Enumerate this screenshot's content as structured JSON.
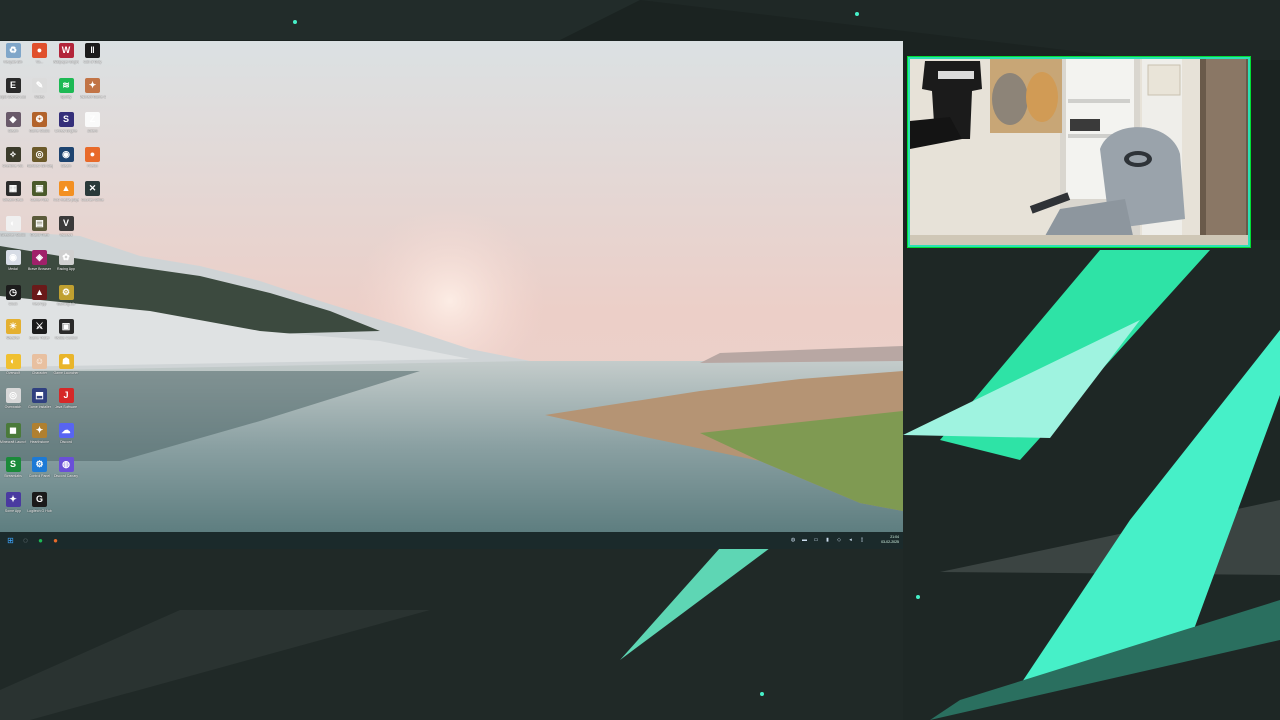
{
  "stream": {
    "accent_color": "#3ee8c0",
    "background_color": "#1a2220"
  },
  "desktop": {
    "icons": [
      {
        "name": "recycle-bin-icon",
        "label": "Recycle Bin",
        "color": "#7fa6c9",
        "glyph": "♻"
      },
      {
        "name": "app-icon",
        "label": "Vo...",
        "color": "#e0502c",
        "glyph": "●"
      },
      {
        "name": "app-icon",
        "label": "Wallpaper Engine",
        "color": "#b3253a",
        "glyph": "W"
      },
      {
        "name": "app-icon",
        "label": "Call of Duty",
        "color": "#1b1b1b",
        "glyph": "‖"
      },
      {
        "name": "app-icon",
        "label": "Epic Games Launcher",
        "color": "#2a2a2a",
        "glyph": "E"
      },
      {
        "name": "app-icon",
        "label": "Notes",
        "color": "#dcdcdc",
        "glyph": "✎"
      },
      {
        "name": "spotify-icon",
        "label": "Spotify",
        "color": "#1db954",
        "glyph": "≋"
      },
      {
        "name": "app-icon",
        "label": "Valorant Game Client",
        "color": "#c27446",
        "glyph": "✦"
      },
      {
        "name": "app-icon",
        "label": "Steam",
        "color": "#6a5a6a",
        "glyph": "◆"
      },
      {
        "name": "app-icon",
        "label": "Game Studio",
        "color": "#b3632b",
        "glyph": "❂"
      },
      {
        "name": "app-icon",
        "label": "Unreal Engine",
        "color": "#352f7a",
        "glyph": "S"
      },
      {
        "name": "app-icon",
        "label": "Zotero",
        "color": "#fafafa",
        "glyph": "Z"
      },
      {
        "name": "app-icon",
        "label": "Overtime Vol.",
        "color": "#3b3b2b",
        "glyph": "⟡"
      },
      {
        "name": "app-icon",
        "label": "Rainbow Six Siege",
        "color": "#6b5a2a",
        "glyph": "◎"
      },
      {
        "name": "steam-icon",
        "label": "Steam",
        "color": "#1e4470",
        "glyph": "◉"
      },
      {
        "name": "firefox-icon",
        "label": "Firefox",
        "color": "#e86a2a",
        "glyph": "●"
      },
      {
        "name": "app-icon",
        "label": "Stream Deck",
        "color": "#2b2b2b",
        "glyph": "▦"
      },
      {
        "name": "app-icon",
        "label": "Game Files",
        "color": "#4a5a2a",
        "glyph": "▣"
      },
      {
        "name": "vlc-icon",
        "label": "VLC media player",
        "color": "#f39021",
        "glyph": "▲"
      },
      {
        "name": "app-icon",
        "label": "Counter-Strike",
        "color": "#2a3a3a",
        "glyph": "✕"
      },
      {
        "name": "app-icon",
        "label": "Streamer Studio",
        "color": "#f0f0f0",
        "glyph": "◐"
      },
      {
        "name": "app-icon",
        "label": "Grand Theft",
        "color": "#5a5a3a",
        "glyph": "▤"
      },
      {
        "name": "app-icon",
        "label": "Valorant",
        "color": "#3a3a3a",
        "glyph": "V"
      },
      {
        "name": "app-icon",
        "label": "Medal",
        "color": "#d8dde6",
        "glyph": "◉"
      },
      {
        "name": "app-icon",
        "label": "Brave Browser",
        "color": "#a0206a",
        "glyph": "◈"
      },
      {
        "name": "app-icon",
        "label": "Racing App",
        "color": "#d0d0d0",
        "glyph": "✿"
      },
      {
        "name": "app-icon",
        "label": "Clock",
        "color": "#1c1c1c",
        "glyph": "◷"
      },
      {
        "name": "app-icon",
        "label": "Red App",
        "color": "#6a1a1a",
        "glyph": "▲"
      },
      {
        "name": "app-icon",
        "label": "Gaming Lib",
        "color": "#c0a030",
        "glyph": "⚙"
      },
      {
        "name": "app-icon",
        "label": "Weather",
        "color": "#e4b030",
        "glyph": "☀"
      },
      {
        "name": "app-icon",
        "label": "Game Trailer",
        "color": "#1b1b1b",
        "glyph": "⚔"
      },
      {
        "name": "app-icon",
        "label": "Nvidia Control",
        "color": "#2a2a2a",
        "glyph": "▣"
      },
      {
        "name": "app-icon",
        "label": "Overwolf",
        "color": "#f0c030",
        "glyph": "◐"
      },
      {
        "name": "app-icon",
        "label": "Character",
        "color": "#e8c0a0",
        "glyph": "☺"
      },
      {
        "name": "app-icon",
        "label": "Game Launcher",
        "color": "#e9b52a",
        "glyph": "☗"
      },
      {
        "name": "app-icon",
        "label": "Overwatch",
        "color": "#d8d8d8",
        "glyph": "◎"
      },
      {
        "name": "app-icon",
        "label": "Game Installer",
        "color": "#304080",
        "glyph": "⬒"
      },
      {
        "name": "app-icon",
        "label": "Java Software",
        "color": "#d62828",
        "glyph": "J"
      },
      {
        "name": "app-icon",
        "label": "Minecraft Launcher",
        "color": "#4a7a3a",
        "glyph": "◼"
      },
      {
        "name": "app-icon",
        "label": "Hearthstone",
        "color": "#b08030",
        "glyph": "✦"
      },
      {
        "name": "discord-icon",
        "label": "Discord",
        "color": "#5865f2",
        "glyph": "☁"
      },
      {
        "name": "app-icon",
        "label": "Streamlabs",
        "color": "#1b8a3a",
        "glyph": "S"
      },
      {
        "name": "app-icon",
        "label": "Control Panel",
        "color": "#1d7ad6",
        "glyph": "⚙"
      },
      {
        "name": "app-icon",
        "label": "Discord Canary",
        "color": "#6a50d8",
        "glyph": "◍"
      },
      {
        "name": "app-icon",
        "label": "Some App",
        "color": "#4a3aa0",
        "glyph": "✦"
      },
      {
        "name": "app-icon",
        "label": "Logitech G Hub",
        "color": "#1a1a1a",
        "glyph": "G"
      }
    ]
  },
  "taskbar": {
    "buttons": [
      {
        "name": "start-icon",
        "glyph": "⊞",
        "color": "#3ca6ff"
      },
      {
        "name": "search-icon",
        "glyph": "◌",
        "color": "#bfc8d0"
      },
      {
        "name": "spotify-icon",
        "glyph": "●",
        "color": "#1db954"
      },
      {
        "name": "firefox-icon",
        "glyph": "●",
        "color": "#e86a2a"
      }
    ],
    "tray": [
      {
        "name": "tray-app-icon",
        "glyph": "◍"
      },
      {
        "name": "tray-monitor-icon",
        "glyph": "▬"
      },
      {
        "name": "tray-app-icon",
        "glyph": "▭"
      },
      {
        "name": "tray-app-icon",
        "glyph": "▮"
      },
      {
        "name": "network-icon",
        "glyph": "◇"
      },
      {
        "name": "volume-icon",
        "glyph": "◂"
      },
      {
        "name": "battery-icon",
        "glyph": "▯"
      }
    ],
    "clock_time": "21:04",
    "clock_date": "03-02-2025"
  }
}
